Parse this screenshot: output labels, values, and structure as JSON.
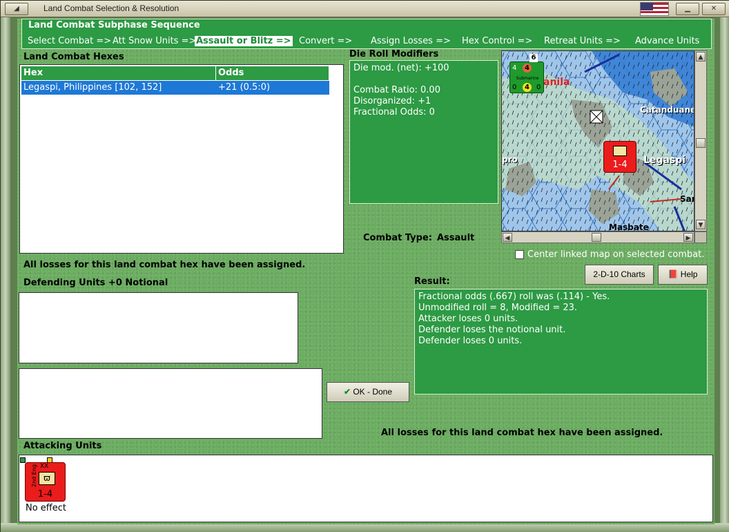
{
  "window": {
    "title": "Land Combat Selection & Resolution",
    "flag_icon": "us-flag-icon"
  },
  "sequence": {
    "title": "Land Combat Subphase Sequence",
    "items": [
      {
        "label": "Select Combat =>",
        "active": false
      },
      {
        "label": "Att Snow Units =>",
        "active": false
      },
      {
        "label": "Assault or Blitz =>",
        "active": true
      },
      {
        "label": "Convert =>",
        "active": false
      },
      {
        "label": "Assign Losses =>",
        "active": false
      },
      {
        "label": "Hex Control =>",
        "active": false
      },
      {
        "label": "Retreat Units =>",
        "active": false
      },
      {
        "label": "Advance Units",
        "active": false
      }
    ]
  },
  "hexes": {
    "title": "Land Combat Hexes",
    "columns": [
      "Hex",
      "Odds"
    ],
    "rows": [
      {
        "hex": "Legaspi, Philippines [102, 152]",
        "odds": "+21 (0.5:0)"
      }
    ],
    "status": "All losses for this land combat hex have been assigned."
  },
  "modifiers": {
    "title": "Die Roll Modifiers",
    "lines": [
      "Die mod. (net): +100",
      "",
      "Combat Ratio: 0.00",
      "Disorganized: +1",
      "Fractional Odds: 0"
    ]
  },
  "combat_type": {
    "label": "Combat Type:",
    "value": "Assault"
  },
  "map": {
    "labels": [
      "anila",
      "Catanduanes",
      "Legaspi",
      "pro",
      "Masbate",
      "San"
    ],
    "friendly_unit": {
      "top_left": "4",
      "top_center": "4",
      "stack": "6",
      "type": "Submarine",
      "bottom_left": "0",
      "bottom_center": "4",
      "bottom_right": "0"
    },
    "enemy_unit": {
      "strength": "1-4"
    }
  },
  "center_map": {
    "label": "Center linked map on selected combat.",
    "checked": false
  },
  "buttons": {
    "charts": "2-D-10 Charts",
    "help": "Help",
    "ok": "OK - Done"
  },
  "defending": {
    "title": "Defending Units +0 Notional"
  },
  "result": {
    "title": "Result:",
    "lines": [
      "Fractional odds (.667) roll was (.114)  - Yes.",
      "Unmodified roll = 8, Modified = 23.",
      "Attacker loses 0 units.",
      "Defender loses the notional unit.",
      "Defender loses 0 units."
    ],
    "status": "All losses for this land combat hex have been assigned."
  },
  "attacking": {
    "title": "Attacking Units",
    "units": [
      {
        "name": "2nd Eng",
        "size": "XX",
        "strength": "1-4",
        "status": "No effect"
      }
    ]
  }
}
